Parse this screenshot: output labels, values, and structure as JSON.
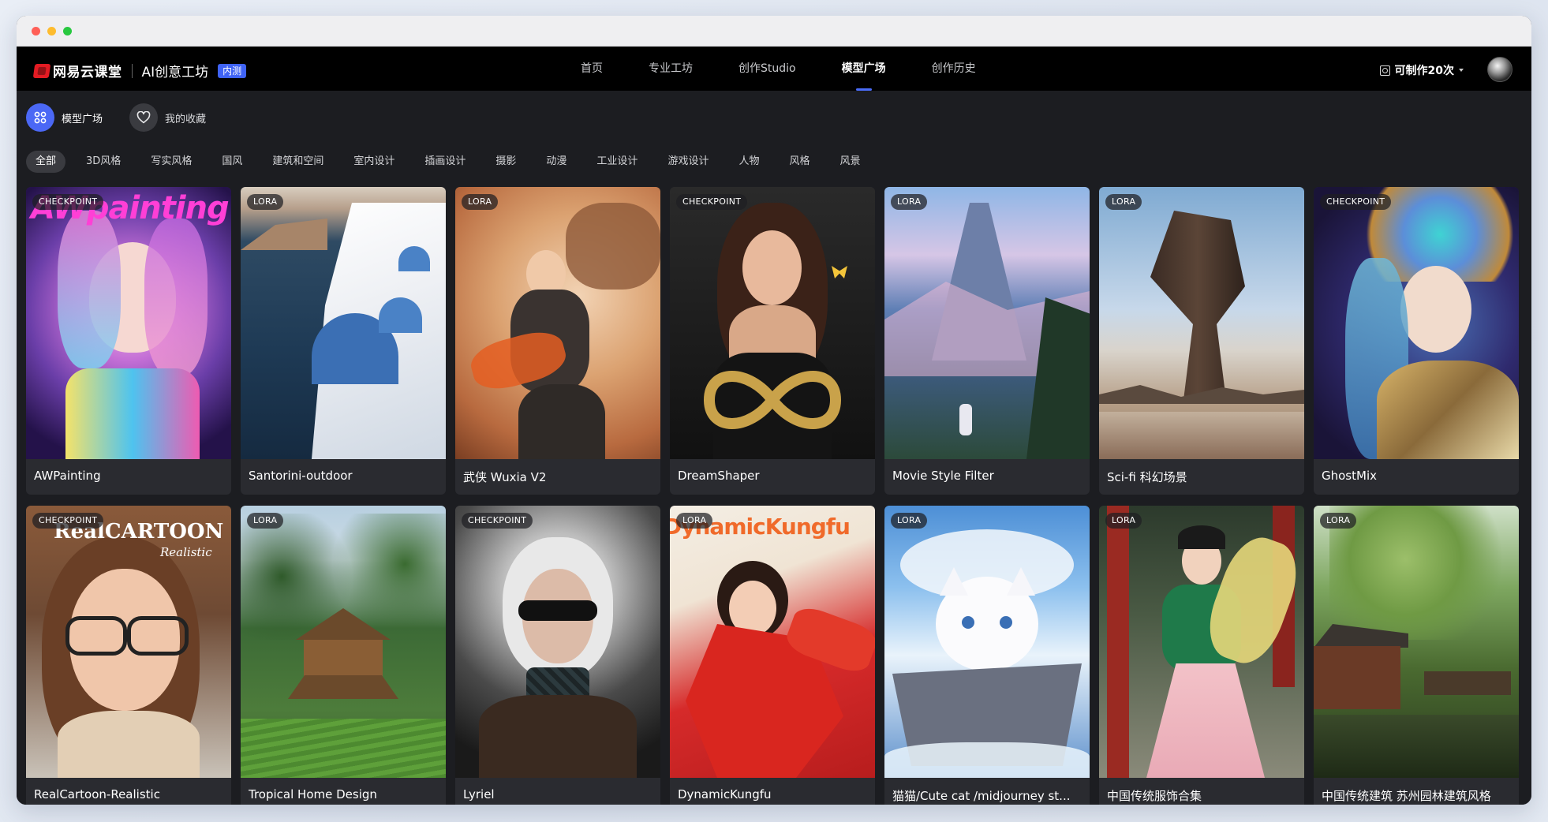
{
  "header": {
    "logo_text": "网易云课堂",
    "product_name": "AI创意工坊",
    "beta_badge": "内测",
    "nav": [
      {
        "label": "首页",
        "active": false
      },
      {
        "label": "专业工坊",
        "active": false
      },
      {
        "label": "创作Studio",
        "active": false
      },
      {
        "label": "模型广场",
        "active": true
      },
      {
        "label": "创作历史",
        "active": false
      }
    ],
    "quota_label": "可制作20次"
  },
  "subtabs": [
    {
      "label": "模型广场",
      "icon": "grid-icon",
      "active": true
    },
    {
      "label": "我的收藏",
      "icon": "heart-icon",
      "active": false
    }
  ],
  "categories": [
    "全部",
    "3D风格",
    "写实风格",
    "国风",
    "建筑和空间",
    "室内设计",
    "插画设计",
    "摄影",
    "动漫",
    "工业设计",
    "游戏设计",
    "人物",
    "风格",
    "风景"
  ],
  "active_category": "全部",
  "models": [
    {
      "title": "AWPainting",
      "type": "CHECKPOINT",
      "art_text": "AWpainting"
    },
    {
      "title": "Santorini-outdoor",
      "type": "LORA"
    },
    {
      "title": "武侠 Wuxia V2",
      "type": "LORA"
    },
    {
      "title": "DreamShaper",
      "type": "CHECKPOINT"
    },
    {
      "title": "Movie Style Filter",
      "type": "LORA"
    },
    {
      "title": "Sci-fi 科幻场景",
      "type": "LORA"
    },
    {
      "title": "GhostMix",
      "type": "CHECKPOINT"
    },
    {
      "title": "RealCartoon-Realistic",
      "type": "CHECKPOINT",
      "art_text": "RealCARTOON",
      "art_subtext": "Realistic"
    },
    {
      "title": "Tropical Home Design",
      "type": "LORA"
    },
    {
      "title": "Lyriel",
      "type": "CHECKPOINT"
    },
    {
      "title": "DynamicKungfu",
      "type": "LORA",
      "art_text": "DynamicKungfu"
    },
    {
      "title": "猫猫/Cute cat /midjourney st...",
      "type": "LORA"
    },
    {
      "title": "中国传统服饰合集",
      "type": "LORA"
    },
    {
      "title": "中国传统建筑 苏州园林建筑风格",
      "type": "LORA"
    }
  ]
}
